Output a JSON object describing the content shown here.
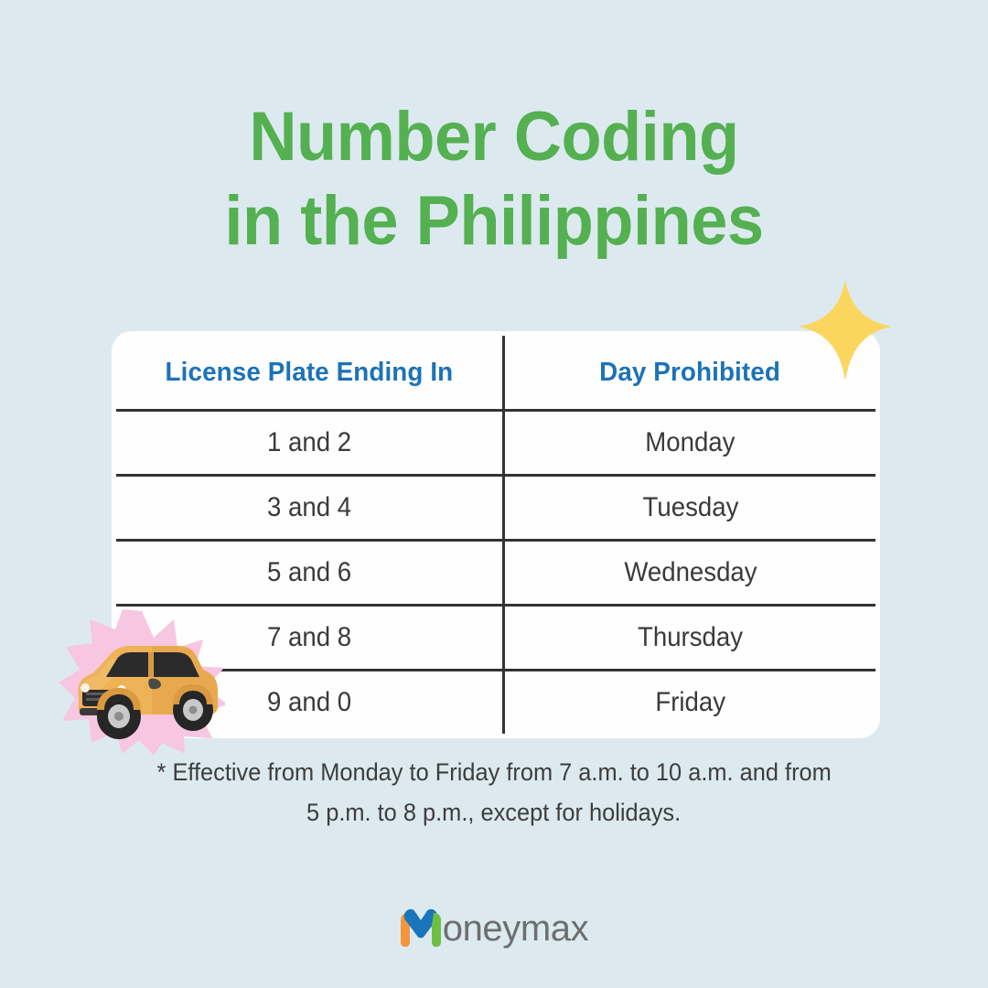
{
  "page": {
    "background_color": "#dceaf0"
  },
  "title": {
    "line1": "Number Coding",
    "line2": "in the Philippines",
    "color": "#54b050"
  },
  "table": {
    "header_color": "#1d72b8",
    "border_color": "#333333",
    "columns": [
      "License Plate Ending In",
      "Day Prohibited"
    ],
    "rows": [
      {
        "plate": "1 and 2",
        "day": "Monday"
      },
      {
        "plate": "3 and 4",
        "day": "Tuesday"
      },
      {
        "plate": "5 and 6",
        "day": "Wednesday"
      },
      {
        "plate": "7 and 8",
        "day": "Thursday"
      },
      {
        "plate": "9 and 0",
        "day": "Friday"
      }
    ]
  },
  "footnote": {
    "line1": "* Effective from Monday to Friday from 7 a.m. to 10 a.m. and from",
    "line2": "5 p.m. to 8 p.m., except for holidays."
  },
  "decorations": {
    "sparkle": {
      "name": "four-point-star-icon",
      "color": "#fbd65f"
    },
    "burst": {
      "name": "starburst-shape",
      "color": "#f7c6e0"
    },
    "car": {
      "name": "suv-illustration",
      "body_color": "#e8a94e"
    }
  },
  "logo": {
    "mark_name": "moneymax-m-icon",
    "word": "oneymax",
    "word_color": "#6d6e70",
    "colors": {
      "orange": "#f4953c",
      "blue": "#1b75bb",
      "green": "#6cbe45"
    }
  }
}
